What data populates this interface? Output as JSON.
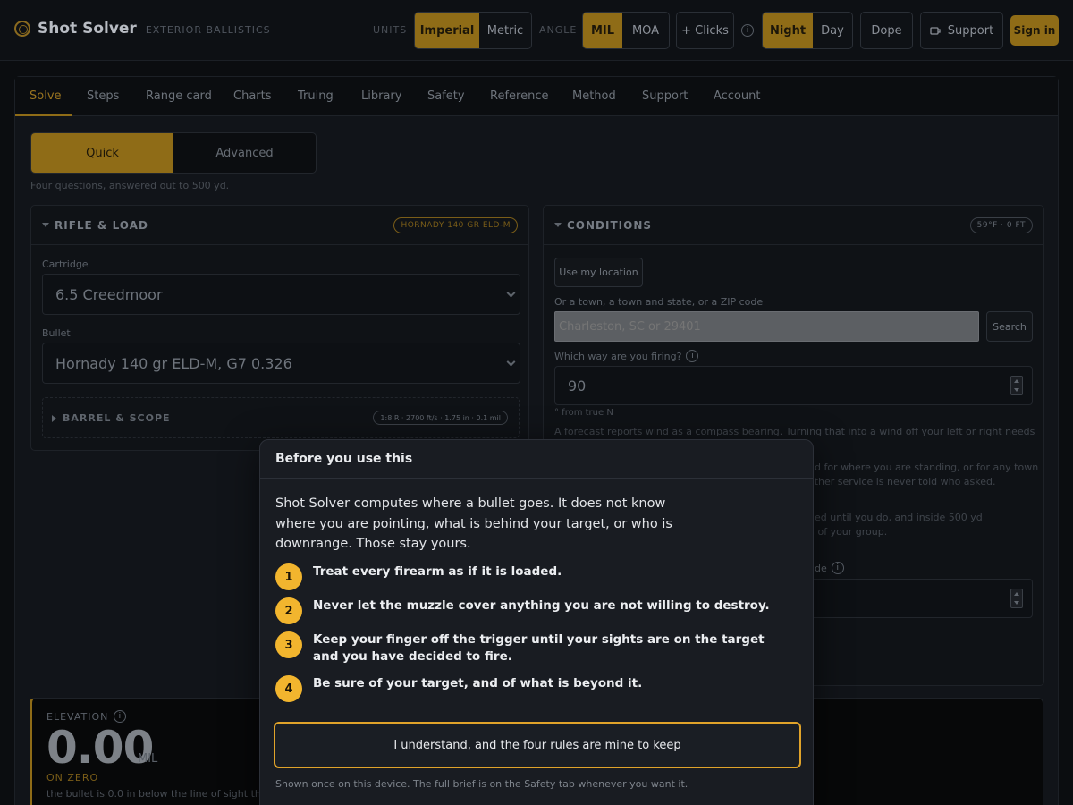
{
  "app": {
    "name": "Shot Solver",
    "tagline": "EXTERIOR BALLISTICS"
  },
  "topbar": {
    "units_label": "UNITS",
    "units_options": [
      "Imperial",
      "Metric"
    ],
    "units_selected": "Imperial",
    "angle_label": "ANGLE",
    "angle_options": [
      "MIL",
      "MOA"
    ],
    "angle_selected": "MIL",
    "clicks_label": "+ Clicks",
    "theme_options": [
      "Night",
      "Day"
    ],
    "theme_selected": "Night",
    "dope_label": "Dope",
    "support_label": "Support",
    "signin_label": "Sign in"
  },
  "tabs": [
    "Solve",
    "Steps",
    "Range card",
    "Charts",
    "Truing",
    "Library",
    "Safety",
    "Reference",
    "Method",
    "Support",
    "Account"
  ],
  "active_tab": "Solve",
  "mode": {
    "options": [
      "Quick",
      "Advanced"
    ],
    "selected": "Quick",
    "hint": "Four questions, answered out to 500 yd."
  },
  "rifle_panel": {
    "title": "RIFLE & LOAD",
    "badge": "HORNADY 140 GR ELD-M",
    "cartridge_label": "Cartridge",
    "cartridge_value": "6.5 Creedmoor",
    "bullet_label": "Bullet",
    "bullet_value": "Hornady 140 gr ELD-M, G7 0.326",
    "barrel_title": "BARREL & SCOPE",
    "barrel_badge": "1:8 R · 2700 ft/s · 1.75 in · 0.1 mil"
  },
  "conditions_panel": {
    "title": "CONDITIONS",
    "badge": "59°F · 0 FT",
    "location_button": "Use my location",
    "location_label": "Or a town, a town and state, or a ZIP code",
    "location_placeholder": "Charleston, SC or 29401",
    "search_button": "Search",
    "bearing_label": "Which way are you firing?",
    "bearing_value": "90",
    "bearing_hint": "° from true N",
    "para1_visible": "A forecast reports wind as a compass bearing. Turning that into a wind off your left or right needs to",
    "para2_visible": "nd for where you are standing, or for any town",
    "para3_visible": "ather service is never told who asked.",
    "para4_visible": "ned until you do, and inside 500 yd",
    "para5_visible": "h of your group.",
    "field_visible_label": "ude"
  },
  "elevation": {
    "label": "ELEVATION",
    "value": "0.00",
    "unit": "MIL",
    "status": "ON ZERO",
    "description": "the bullet is 0.0 in below the line of sight ther"
  },
  "modal": {
    "title": "Before you use this",
    "intro": "Shot Solver computes where a bullet goes. It does not know where you are pointing, what is behind your target, or who is downrange. Those stay yours.",
    "rules": [
      {
        "num": "1",
        "text": "Treat every firearm as if it is loaded."
      },
      {
        "num": "2",
        "text": "Never let the muzzle cover anything you are not willing to destroy."
      },
      {
        "num": "3",
        "text": "Keep your finger off the trigger until your sights are on the target and you have decided to fire."
      },
      {
        "num": "4",
        "text": "Be sure of your target, and of what is beyond it."
      }
    ],
    "ack_button": "I understand, and the four rules are mine to keep",
    "footer": "Shown once on this device. The full brief is on the Safety tab whenever you want it."
  },
  "colors": {
    "accent": "#8f6c17",
    "accent_bright": "#f2b52e",
    "background": "#0b0d10",
    "modal_bg": "#191c22"
  }
}
